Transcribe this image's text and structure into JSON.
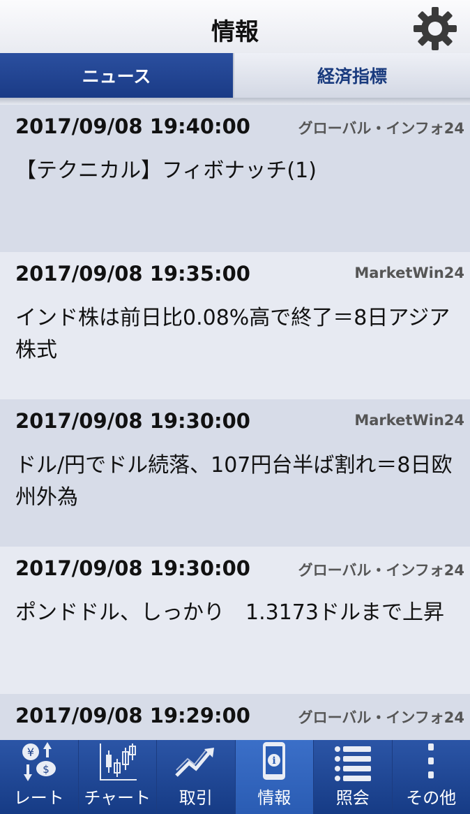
{
  "header": {
    "title": "情報"
  },
  "tabs": [
    {
      "label": "ニュース",
      "active": true
    },
    {
      "label": "経済指標",
      "active": false
    }
  ],
  "news": [
    {
      "date": "2017/09/08 19:40:00",
      "source": "グローバル・インフォ24",
      "title": "【テクニカル】フィボナッチ(1)"
    },
    {
      "date": "2017/09/08 19:35:00",
      "source": "MarketWin24",
      "title": "インド株は前日比0.08%高で終了＝8日アジア株式"
    },
    {
      "date": "2017/09/08 19:30:00",
      "source": "MarketWin24",
      "title": "ドル/円でドル続落、107円台半ば割れ＝8日欧州外為"
    },
    {
      "date": "2017/09/08 19:30:00",
      "source": "グローバル・インフォ24",
      "title": "ポンドドル、しっかり　1.3173ドルまで上昇"
    },
    {
      "date": "2017/09/08 19:29:00",
      "source": "グローバル・インフォ24",
      "title": ""
    }
  ],
  "bottom_nav": [
    {
      "label": "レート",
      "icon": "rate-icon"
    },
    {
      "label": "チャート",
      "icon": "chart-icon"
    },
    {
      "label": "取引",
      "icon": "trade-icon"
    },
    {
      "label": "情報",
      "icon": "info-phone-icon",
      "active": true
    },
    {
      "label": "照会",
      "icon": "list-icon"
    },
    {
      "label": "その他",
      "icon": "more-icon"
    }
  ],
  "colors": {
    "nav_bg": "#1a3f8a",
    "active_tab": "#1f418e",
    "row_odd": "#d7dce8",
    "row_even": "#e7eaf2"
  }
}
